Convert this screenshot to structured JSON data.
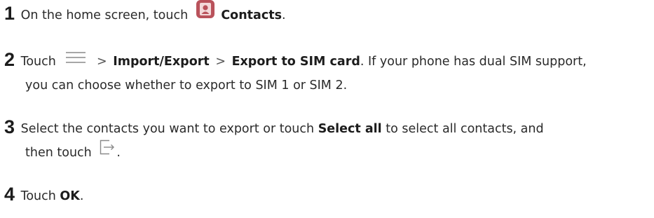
{
  "steps": [
    {
      "number": "1",
      "text_before": "On the home screen, touch",
      "icon": "contacts-app-icon",
      "bold": "Contacts",
      "text_after": "."
    },
    {
      "number": "2",
      "text_before": "Touch",
      "icon": "menu-icon",
      "sep1": ">",
      "bold1": "Import/Export",
      "sep2": ">",
      "bold2": "Export to SIM card",
      "text_after": ". If your phone has dual SIM support,",
      "line2": "you can choose whether to export to SIM 1 or SIM 2."
    },
    {
      "number": "3",
      "text_before": "Select the contacts you want to export or touch",
      "bold": "Select all",
      "text_after": "to select all contacts, and",
      "line2_before": "then touch",
      "icon": "export-icon",
      "line2_after": "."
    },
    {
      "number": "4",
      "text_before": "Touch",
      "bold": "OK",
      "text_after": "."
    }
  ],
  "colors": {
    "contacts_icon_bg": "#b9525b",
    "icon_stroke": "#8a8a8a",
    "text": "#2a2a2a"
  }
}
